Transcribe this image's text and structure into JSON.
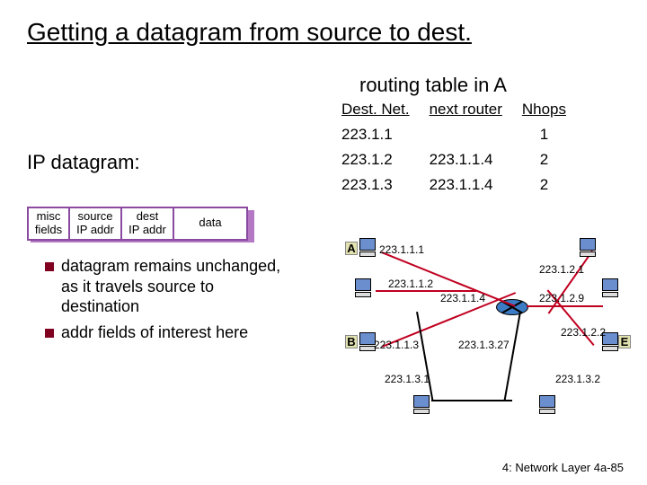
{
  "title": "Getting a datagram from source to dest.",
  "routing_table_caption": "routing table in A",
  "routing_table": {
    "headers": [
      "Dest. Net.",
      "next router",
      "Nhops"
    ],
    "rows": [
      {
        "dest": "223.1.1",
        "next": "",
        "hops": "1"
      },
      {
        "dest": "223.1.2",
        "next": "223.1.1.4",
        "hops": "2"
      },
      {
        "dest": "223.1.3",
        "next": "223.1.1.4",
        "hops": "2"
      }
    ]
  },
  "subheading": "IP datagram:",
  "packet": {
    "misc": "misc\nfields",
    "src": "source\nIP addr",
    "dst": "dest\nIP addr",
    "data": "data"
  },
  "bullets": [
    "datagram remains unchanged, as it travels source to destination",
    "addr fields of interest here"
  ],
  "diagram": {
    "node_labels": {
      "A": "A",
      "B": "B",
      "E": "E"
    },
    "ip": {
      "a": "223.1.1.1",
      "r1a": "223.1.1.2",
      "r1b": "223.1.1.4",
      "b": "223.1.1.3",
      "r2a": "223.1.2.1",
      "r2b": "223.1.2.9",
      "e": "223.1.2.2",
      "r3a": "223.1.3.27",
      "bot1": "223.1.3.1",
      "bot2": "223.1.3.2"
    }
  },
  "footer": "4: Network Layer   4a-85"
}
